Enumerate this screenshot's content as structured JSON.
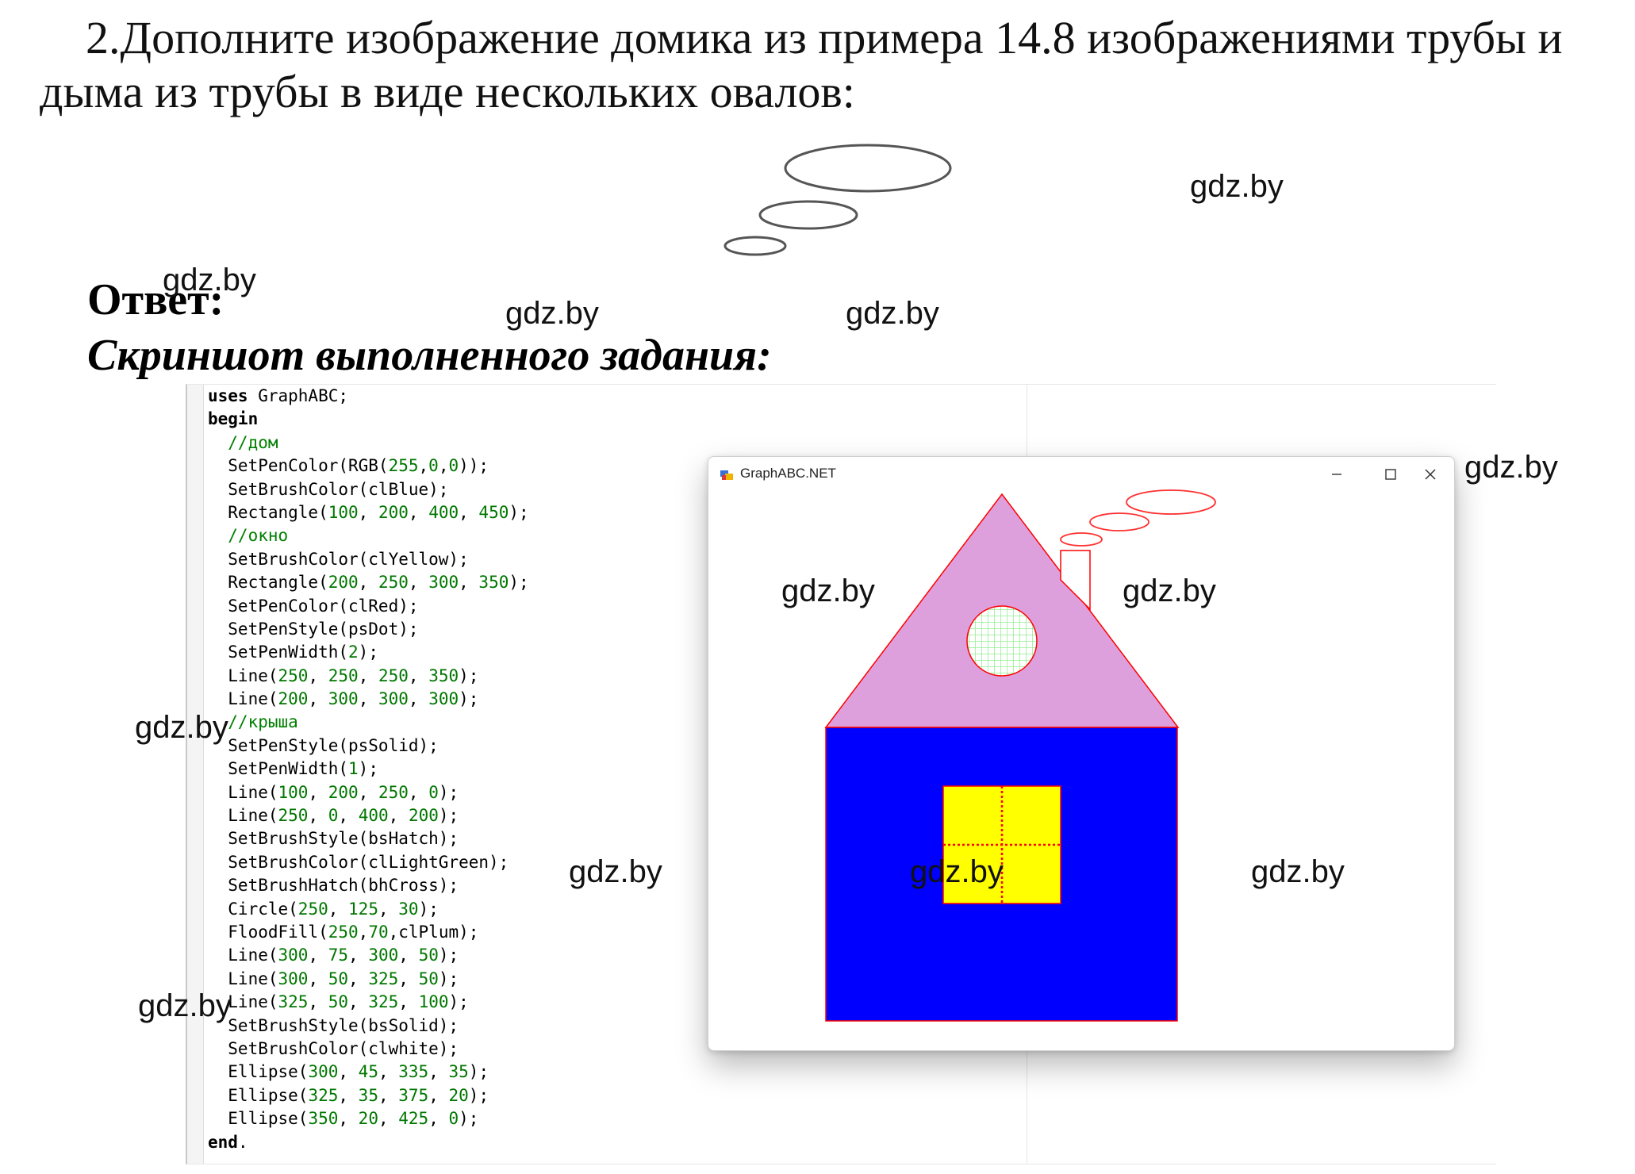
{
  "task_text": "2.Дополните изображение домика из примера 14.8 изображениями трубы и дыма из трубы в виде нескольких овалов:",
  "answer_label": "Ответ:",
  "screenshot_label": "Скриншот выполненного задания:",
  "watermark": "gdz.by",
  "code": {
    "lines": [
      "uses GraphABC;",
      "begin",
      "  //дом",
      "  SetPenColor(RGB(255,0,0));",
      "  SetBrushColor(clBlue);",
      "  Rectangle(100, 200, 400, 450);",
      "  //окно",
      "  SetBrushColor(clYellow);",
      "  Rectangle(200, 250, 300, 350);",
      "  SetPenColor(clRed);",
      "  SetPenStyle(psDot);",
      "  SetPenWidth(2);",
      "  Line(250, 250, 250, 350);",
      "  Line(200, 300, 300, 300);",
      "  //крыша",
      "  SetPenStyle(psSolid);",
      "  SetPenWidth(1);",
      "  Line(100, 200, 250, 0);",
      "  Line(250, 0, 400, 200);",
      "  SetBrushStyle(bsHatch);",
      "  SetBrushColor(clLightGreen);",
      "  SetBrushHatch(bhCross);",
      "  Circle(250, 125, 30);",
      "  FloodFill(250,70,clPlum);",
      "  Line(300, 75, 300, 50);",
      "  Line(300, 50, 325, 50);",
      "  Line(325, 50, 325, 100);",
      "  SetBrushStyle(bsSolid);",
      "  SetBrushColor(clwhite);",
      "  Ellipse(300, 45, 335, 35);",
      "  Ellipse(325, 35, 375, 20);",
      "  Ellipse(350, 20, 425, 0);",
      "end."
    ]
  },
  "window": {
    "title": "GraphABC.NET",
    "minimize_glyph": "–",
    "maximize_glyph": "☐",
    "close_glyph": "✕"
  },
  "colors": {
    "wall": "#0000ff",
    "roof": "#dda0dd",
    "window_fill": "#ffff00",
    "pen": "#ff0000",
    "hatch": "#90ee90",
    "smoke_outline": "#ff3030",
    "task_oval_outline": "#555555"
  }
}
